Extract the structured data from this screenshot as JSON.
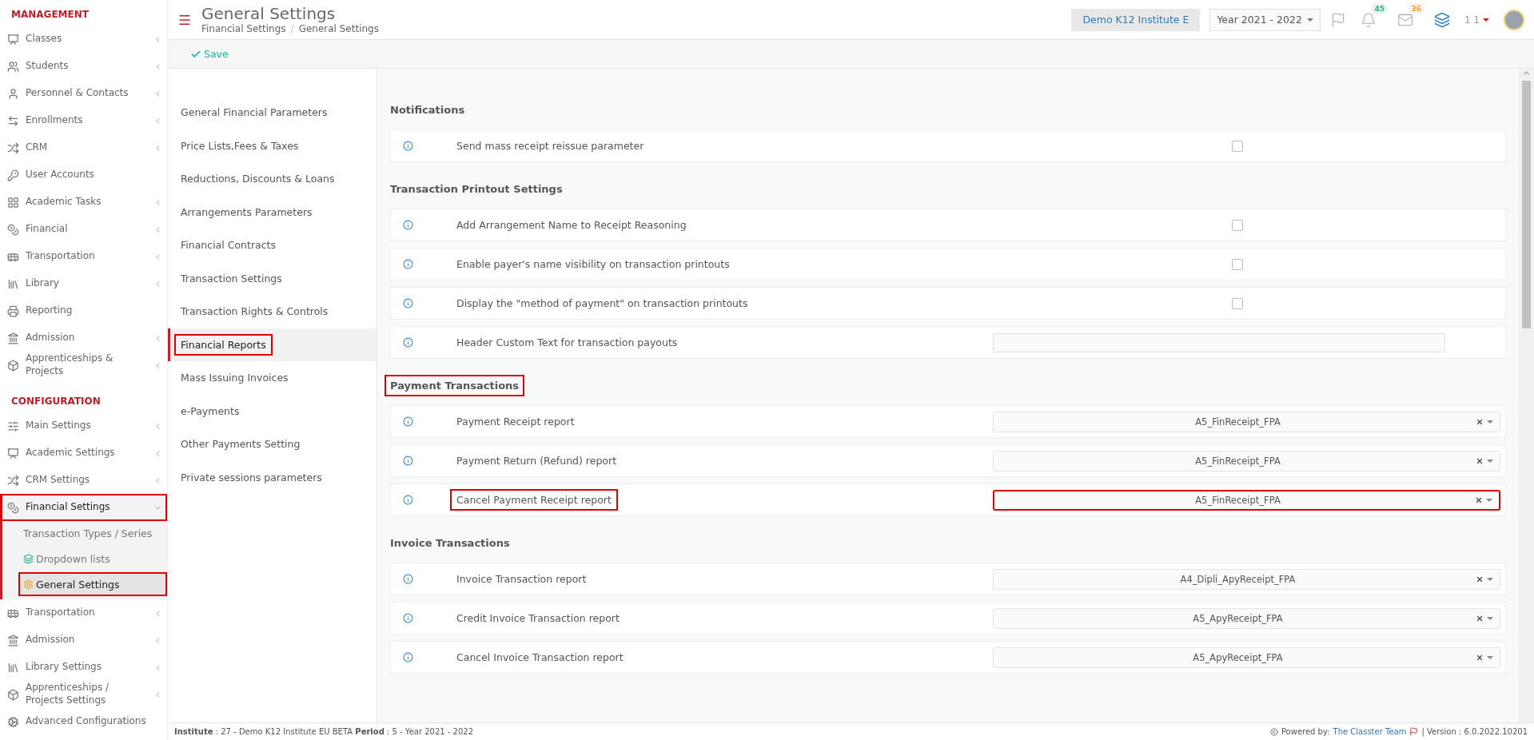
{
  "sidebar": {
    "sections": [
      {
        "title": "MANAGEMENT",
        "items": [
          {
            "label": "Classes",
            "kind": "menu",
            "expanded": false,
            "highlighted": false
          },
          {
            "label": "Students",
            "kind": "menu",
            "expanded": false,
            "highlighted": false
          },
          {
            "label": "Personnel & Contacts",
            "kind": "menu",
            "expanded": false,
            "highlighted": false
          },
          {
            "label": "Enrollments",
            "kind": "menu",
            "expanded": false,
            "highlighted": false
          },
          {
            "label": "CRM",
            "kind": "menu",
            "expanded": false,
            "highlighted": false
          },
          {
            "label": "User Accounts",
            "kind": "link",
            "expanded": false,
            "highlighted": false
          },
          {
            "label": "Academic Tasks",
            "kind": "menu",
            "expanded": false,
            "highlighted": false
          },
          {
            "label": "Financial",
            "kind": "menu",
            "expanded": false,
            "highlighted": false
          },
          {
            "label": "Transportation",
            "kind": "menu",
            "expanded": false,
            "highlighted": false
          },
          {
            "label": "Library",
            "kind": "menu",
            "expanded": false,
            "highlighted": false
          },
          {
            "label": "Reporting",
            "kind": "link",
            "expanded": false,
            "highlighted": false
          },
          {
            "label": "Admission",
            "kind": "menu",
            "expanded": false,
            "highlighted": false
          },
          {
            "label": "Apprenticeships & Projects",
            "kind": "menu",
            "expanded": false,
            "highlighted": false
          }
        ]
      },
      {
        "title": "CONFIGURATION",
        "items": [
          {
            "label": "Main Settings",
            "kind": "menu",
            "expanded": false,
            "highlighted": false
          },
          {
            "label": "Academic Settings",
            "kind": "menu",
            "expanded": false,
            "highlighted": false
          },
          {
            "label": "CRM Settings",
            "kind": "menu",
            "expanded": false,
            "highlighted": false
          },
          {
            "label": "Financial Settings",
            "kind": "menu",
            "expanded": true,
            "highlighted": true,
            "children": [
              {
                "label": "Transaction Types / Series",
                "selected": false,
                "highlighted": false
              },
              {
                "label": "Dropdown lists",
                "selected": false,
                "highlighted": false
              },
              {
                "label": "General Settings",
                "selected": true,
                "highlighted": true
              }
            ]
          },
          {
            "label": "Transportation",
            "kind": "menu",
            "expanded": false,
            "highlighted": false
          },
          {
            "label": "Admission",
            "kind": "menu",
            "expanded": false,
            "highlighted": false
          },
          {
            "label": "Library Settings",
            "kind": "menu",
            "expanded": false,
            "highlighted": false
          },
          {
            "label": "Apprenticeships / Projects Settings",
            "kind": "menu",
            "expanded": false,
            "highlighted": false
          },
          {
            "label": "Advanced Configurations",
            "kind": "link",
            "expanded": false,
            "highlighted": false
          }
        ]
      }
    ]
  },
  "header": {
    "title": "General Settings",
    "breadcrumb": [
      "Financial Settings",
      "General Settings"
    ],
    "breadcrumb_separator": "/",
    "institute": "Demo K12 Institute E",
    "year": "Year 2021 - 2022",
    "notifications_badge": "45",
    "messages_badge": "36",
    "user": "1 1"
  },
  "toolbar": {
    "save": "Save"
  },
  "settings_menu": [
    {
      "label": "General Financial Parameters",
      "selected": false,
      "highlighted": false
    },
    {
      "label": "Price Lists,Fees & Taxes",
      "selected": false,
      "highlighted": false
    },
    {
      "label": "Reductions, Discounts & Loans",
      "selected": false,
      "highlighted": false
    },
    {
      "label": "Arrangements Parameters",
      "selected": false,
      "highlighted": false
    },
    {
      "label": "Financial Contracts",
      "selected": false,
      "highlighted": false
    },
    {
      "label": "Transaction Settings",
      "selected": false,
      "highlighted": false
    },
    {
      "label": "Transaction Rights & Controls",
      "selected": false,
      "highlighted": false
    },
    {
      "label": "Financial Reports",
      "selected": true,
      "highlighted": true
    },
    {
      "label": "Mass Issuing Invoices",
      "selected": false,
      "highlighted": false
    },
    {
      "label": "e-Payments",
      "selected": false,
      "highlighted": false
    },
    {
      "label": "Other Payments Setting",
      "selected": false,
      "highlighted": false
    },
    {
      "label": "Private sessions parameters",
      "selected": false,
      "highlighted": false
    }
  ],
  "sections": [
    {
      "title": "Notifications",
      "highlighted": false,
      "rows": [
        {
          "label": "Send mass receipt reissue parameter",
          "kind": "checkbox",
          "checked": false,
          "highlighted": false
        }
      ]
    },
    {
      "title": "Transaction Printout Settings",
      "highlighted": false,
      "rows": [
        {
          "label": "Add Arrangement Name to Receipt Reasoning",
          "kind": "checkbox",
          "checked": false,
          "highlighted": false
        },
        {
          "label": "Enable payer's name visibility on transaction printouts",
          "kind": "checkbox",
          "checked": false,
          "highlighted": false
        },
        {
          "label": "Display the \"method of payment\" on transaction printouts",
          "kind": "checkbox",
          "checked": false,
          "highlighted": false
        },
        {
          "label": "Header Custom Text for transaction payouts",
          "kind": "text",
          "highlighted": false
        }
      ]
    },
    {
      "title": "Payment Transactions",
      "highlighted": true,
      "rows": [
        {
          "label": "Payment Receipt report",
          "kind": "select",
          "value": "A5_FinReceipt_FPA",
          "highlighted": false,
          "control_highlighted": false
        },
        {
          "label": "Payment Return (Refund) report",
          "kind": "select",
          "value": "A5_FinReceipt_FPA",
          "highlighted": false,
          "control_highlighted": false
        },
        {
          "label": "Cancel Payment Receipt report",
          "kind": "select",
          "value": "A5_FinReceipt_FPA",
          "highlighted": true,
          "control_highlighted": true
        }
      ]
    },
    {
      "title": "Invoice Transactions",
      "highlighted": false,
      "rows": [
        {
          "label": "Invoice Transaction report",
          "kind": "select",
          "value": "A4_Dipli_ApyReceipt_FPA",
          "highlighted": false,
          "control_highlighted": false
        },
        {
          "label": "Credit Invoice Transaction report",
          "kind": "select",
          "value": "A5_ApyReceipt_FPA",
          "highlighted": false,
          "control_highlighted": false
        },
        {
          "label": "Cancel Invoice Transaction report",
          "kind": "select",
          "value": "A5_ApyReceipt_FPA",
          "highlighted": false,
          "control_highlighted": false
        }
      ]
    }
  ],
  "footer": {
    "info": "**Institute** : 27 - Demo K12 Institute EU BETA **Period** : 5 - Year 2021 - 2022",
    "powered_by": "Powered by:",
    "team": "The Classter Team",
    "version": "| Version : 6.0.2022.10201"
  }
}
